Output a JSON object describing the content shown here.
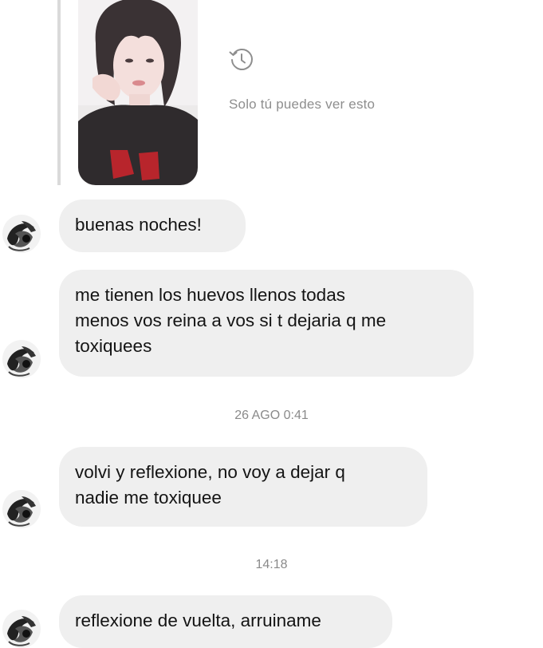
{
  "reply_preview": {
    "photo_icon": "person-photo",
    "visibility_icon": "history-icon",
    "visibility_text": "Solo tú puedes ver esto"
  },
  "avatar_icon": "avatar-icon",
  "messages": [
    {
      "text": "buenas noches!"
    },
    {
      "text": "me tienen los huevos llenos todas\nmenos vos reina a vos si t dejaria q me\ntoxiquees"
    },
    {
      "text": "volvi y reflexione, no voy a dejar q\nnadie me toxiquee"
    },
    {
      "text": "reflexione de vuelta, arruiname"
    }
  ],
  "timestamps": [
    "26 AGO 0:41",
    "14:18"
  ],
  "colors": {
    "bubble_bg": "#efefef",
    "meta_text": "#8e8e8e",
    "background": "#ffffff"
  }
}
